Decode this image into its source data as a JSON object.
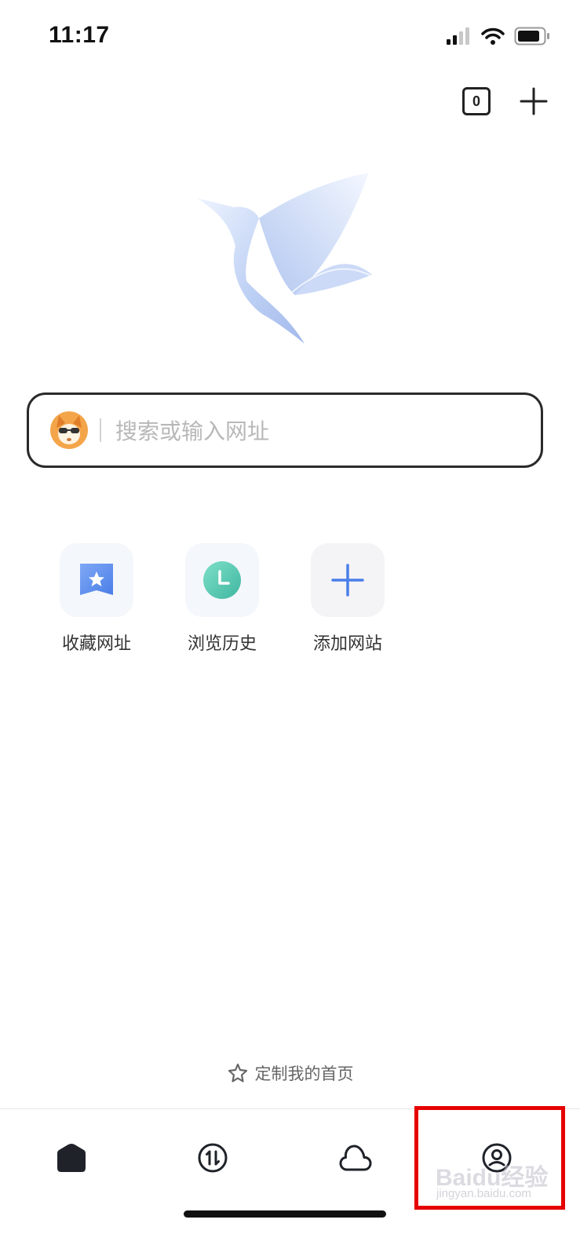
{
  "status_bar": {
    "time": "11:17"
  },
  "top_actions": {
    "tab_count": "0"
  },
  "search": {
    "placeholder": "搜索或输入网址"
  },
  "shortcuts": [
    {
      "label": "收藏网址",
      "icon": "bookmark-star-icon"
    },
    {
      "label": "浏览历史",
      "icon": "clock-icon"
    },
    {
      "label": "添加网站",
      "icon": "plus-icon"
    }
  ],
  "customize": {
    "label": "定制我的首页"
  },
  "tab_bar": {
    "items": [
      {
        "name": "home",
        "icon": "home-icon"
      },
      {
        "name": "transfer",
        "icon": "transfer-icon"
      },
      {
        "name": "cloud",
        "icon": "cloud-icon"
      },
      {
        "name": "profile",
        "icon": "profile-icon"
      }
    ]
  },
  "watermark": {
    "text": "Baidu经验",
    "sub": "jingyan.baidu.com"
  },
  "colors": {
    "highlight": "#e60000",
    "accent_blue": "#4a7ee8",
    "clock_green": "#4bc6ad"
  }
}
